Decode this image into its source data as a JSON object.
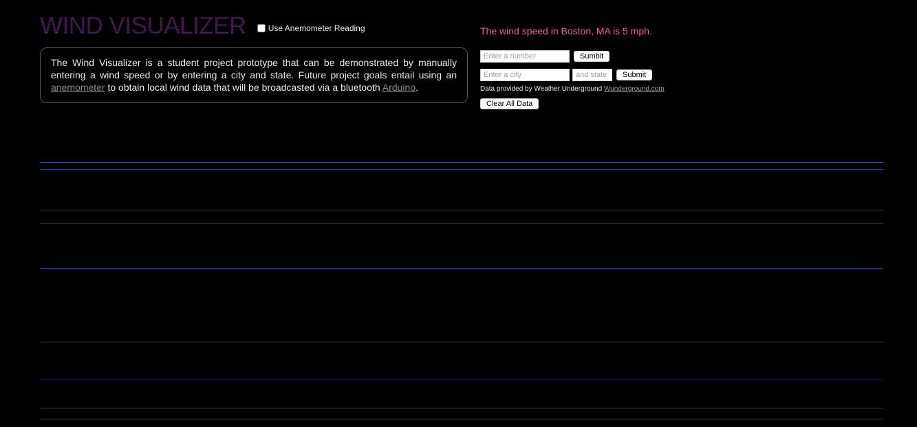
{
  "header": {
    "title": "WIND VISUALIZER",
    "anemometer_label": "Use Anemometer Reading"
  },
  "description": {
    "text_before_anemometer": "The Wind Visualizer is a student project prototype that can be demonstrated by manually entering a wind speed or by entering a city and state. Future project goals entail using an ",
    "anemometer_link": "anemometer",
    "text_middle": " to obtain local wind data that will be broadcasted via a bluetooth ",
    "arduino_link": "Arduino",
    "text_end": "."
  },
  "status": {
    "wind_message": "The wind speed in Boston, MA is 5 mph."
  },
  "speed_form": {
    "placeholder": "Enter a number",
    "value": "",
    "submit_label": "Sumbit"
  },
  "city_form": {
    "city_placeholder": "Enter a city",
    "state_placeholder": "and state",
    "submit_label": "Submit"
  },
  "attribution": {
    "text": "Data provided by Weather Underground ",
    "link": "Wunderground.com"
  },
  "clear_button_label": "Clear All Data",
  "colors": {
    "accent_pink": "#ee5fa6",
    "wind_line_blue": "#233d96",
    "background": "#000000"
  }
}
